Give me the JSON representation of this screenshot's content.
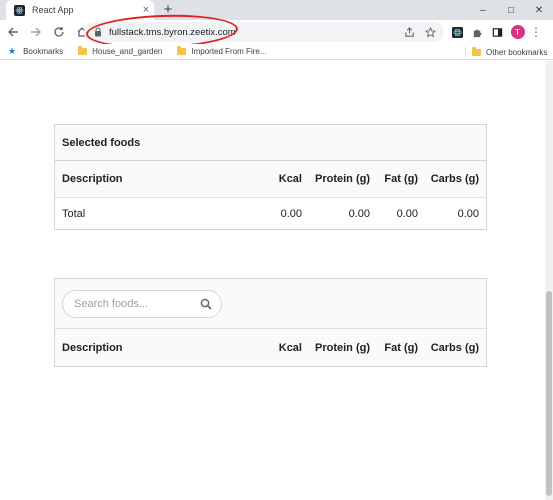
{
  "browser": {
    "tab_title": "React App",
    "tab_close": "×",
    "new_tab": "+",
    "url": "fullstack.tms.byron.zeetix.com",
    "window_minimize": "–",
    "window_maximize": "□",
    "window_close": "✕",
    "avatar_letter": "T",
    "menu": "⋮"
  },
  "bookmarks": {
    "label": "Bookmarks",
    "items": [
      "House_and_garden",
      "Imported From Fire..."
    ],
    "other": "Other bookmarks"
  },
  "selected_foods": {
    "title": "Selected foods",
    "columns": [
      "Description",
      "Kcal",
      "Protein (g)",
      "Fat (g)",
      "Carbs (g)"
    ],
    "total": {
      "label": "Total",
      "kcal": "0.00",
      "protein": "0.00",
      "fat": "0.00",
      "carbs": "0.00"
    }
  },
  "food_search": {
    "placeholder": "Search foods...",
    "value": "",
    "columns": [
      "Description",
      "Kcal",
      "Protein (g)",
      "Fat (g)",
      "Carbs (g)"
    ]
  },
  "colors": {
    "annotation_circle": "#e0241b",
    "avatar": "#d63384",
    "folder": "#f5c24c"
  }
}
